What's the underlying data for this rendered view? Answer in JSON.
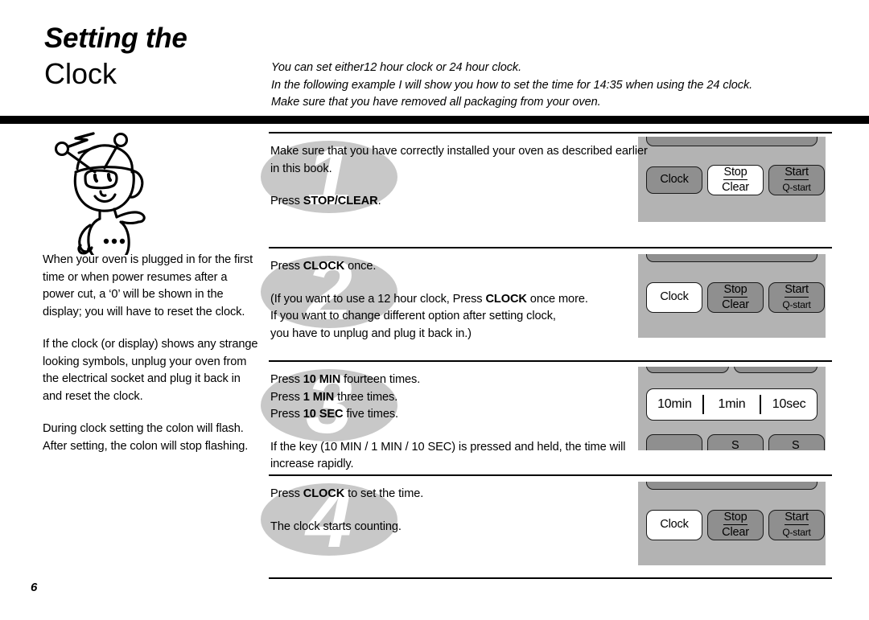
{
  "header": {
    "title_line1": "Setting the",
    "title_line2": "Clock",
    "intro_lines": [
      "You can set either12 hour clock or 24 hour clock.",
      "In the following example I will show you how to set the time for 14:35 when using the 24 clock.",
      "Make sure that you have removed all packaging from your oven."
    ]
  },
  "left_column": {
    "paragraphs": [
      "When your oven is plugged in for the first time or when power resumes after a power cut, a ‘0’ will be shown in the display; you will have to reset the clock.",
      "If the clock (or display) shows any strange looking symbols, unplug your oven from the electrical socket and plug it back in and reset the clock.",
      "During clock setting the colon will flash. After setting, the colon will stop flashing."
    ]
  },
  "page_number": "6",
  "steps": [
    {
      "number": "1",
      "lines": [
        {
          "text": "Make sure that you have correctly installed your oven as described earlier in this book.",
          "gap": false
        },
        {
          "pre": "Press ",
          "bold": "STOP/CLEAR",
          "post": ".",
          "gap": true
        }
      ]
    },
    {
      "number": "2",
      "lines": [
        {
          "pre": "Press ",
          "bold": "CLOCK",
          "post": " once.",
          "gap": false
        },
        {
          "pre": "(If you want to use a 12 hour clock, Press ",
          "bold": "CLOCK",
          "post": " once more.",
          "gap": true
        },
        {
          "text": "If you want to change different option after setting clock,",
          "gap": false
        },
        {
          "text": "you have to unplug and plug it back in.)",
          "gap": false
        }
      ]
    },
    {
      "number": "3",
      "lines": [
        {
          "pre": "Press ",
          "bold": "10 MIN",
          "post": " fourteen times.",
          "gap": false
        },
        {
          "pre": "Press ",
          "bold": "1 MIN",
          "post": " three  times.",
          "gap": false
        },
        {
          "pre": "Press ",
          "bold": "10 SEC",
          "post": " five  times.",
          "gap": false
        },
        {
          "text": "If the key (10 MIN / 1 MIN / 10 SEC) is pressed and held, the time will increase rapidly.",
          "gap": true
        }
      ]
    },
    {
      "number": "4",
      "lines": [
        {
          "pre": "Press ",
          "bold": "CLOCK",
          "post": " to set the time.",
          "gap": false
        },
        {
          "text": "The clock starts counting.",
          "gap": true
        }
      ]
    }
  ],
  "panels": [
    {
      "name": "panel-step-1",
      "buttons": [
        {
          "label": "Clock",
          "highlight": false
        },
        {
          "top": "Stop",
          "bottom": "Clear",
          "highlight": true
        },
        {
          "top": "Start",
          "bottom": "Q-start",
          "highlight": false
        }
      ]
    },
    {
      "name": "panel-step-2",
      "buttons": [
        {
          "label": "Clock",
          "highlight": true
        },
        {
          "top": "Stop",
          "bottom": "Clear",
          "highlight": false
        },
        {
          "top": "Start",
          "bottom": "Q-start",
          "highlight": false
        }
      ]
    },
    {
      "name": "panel-step-3",
      "time_buttons": [
        "10min",
        "1min",
        "10sec"
      ]
    },
    {
      "name": "panel-step-4",
      "buttons": [
        {
          "label": "Clock",
          "highlight": true
        },
        {
          "top": "Stop",
          "bottom": "Clear",
          "highlight": false
        },
        {
          "top": "Start",
          "bottom": "Q-start",
          "highlight": false
        }
      ]
    }
  ],
  "colors": {
    "panel_background": "#b3b3b3",
    "button_gray": "#8f8f8f",
    "button_highlight": "#ffffff",
    "watermark_gray": "#c8c8c8",
    "rule_black": "#000000"
  }
}
